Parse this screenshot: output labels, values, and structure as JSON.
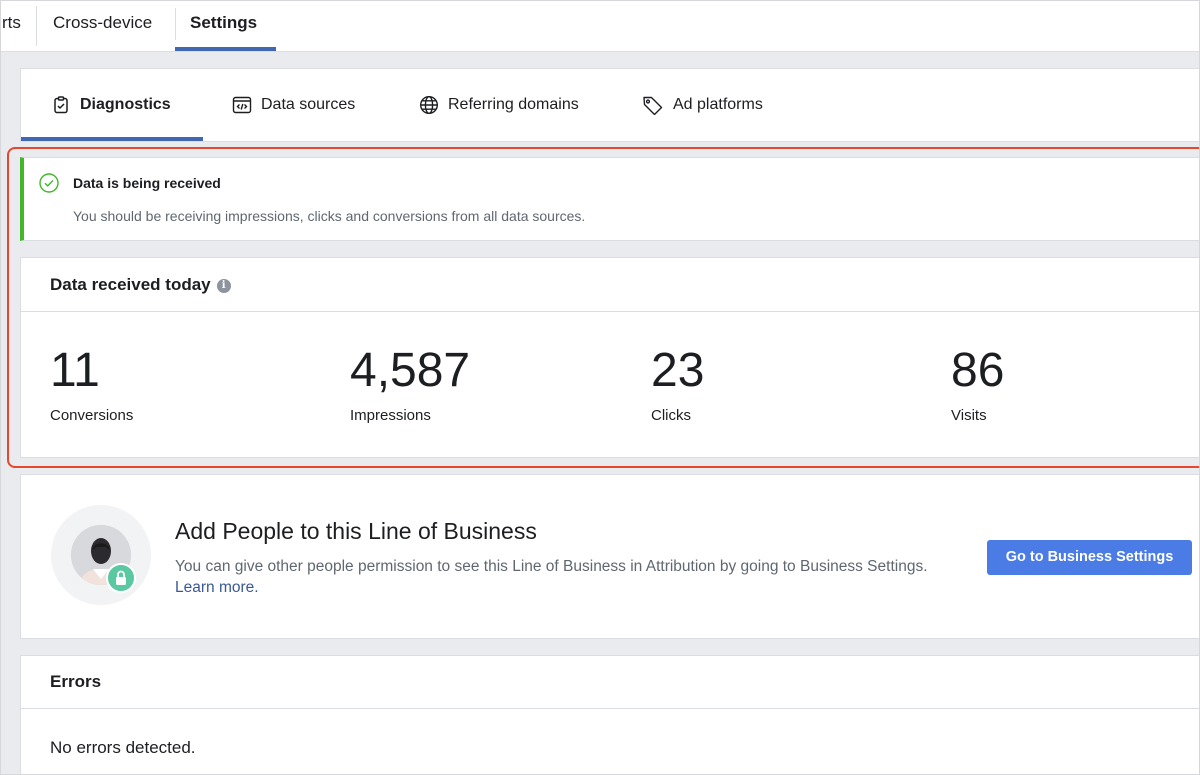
{
  "top_nav": {
    "tabs": [
      {
        "label": "rts"
      },
      {
        "label": "Cross-device"
      },
      {
        "label": "Settings"
      }
    ]
  },
  "sub_tabs": [
    {
      "label": "Diagnostics",
      "icon": "clipboard-check-icon"
    },
    {
      "label": "Data sources",
      "icon": "code-window-icon"
    },
    {
      "label": "Referring domains",
      "icon": "globe-icon"
    },
    {
      "label": "Ad platforms",
      "icon": "tag-icon"
    }
  ],
  "alert": {
    "title": "Data is being received",
    "text": "You should be receiving impressions, clicks and conversions from all data sources.",
    "color": "#42b72a"
  },
  "data_received": {
    "title": "Data received today",
    "metrics": [
      {
        "value": "11",
        "label": "Conversions"
      },
      {
        "value": "4,587",
        "label": "Impressions"
      },
      {
        "value": "23",
        "label": "Clicks"
      },
      {
        "value": "86",
        "label": "Visits"
      }
    ]
  },
  "add_people": {
    "title": "Add People to this Line of Business",
    "text": "You can give other people permission to see this Line of Business in Attribution by going to Business Settings.",
    "link": "Learn more.",
    "button": "Go to Business Settings"
  },
  "errors": {
    "title": "Errors",
    "text": "No errors detected."
  },
  "colors": {
    "accent": "#4267b2",
    "button": "#4b7be5",
    "highlight": "#e5472f"
  }
}
